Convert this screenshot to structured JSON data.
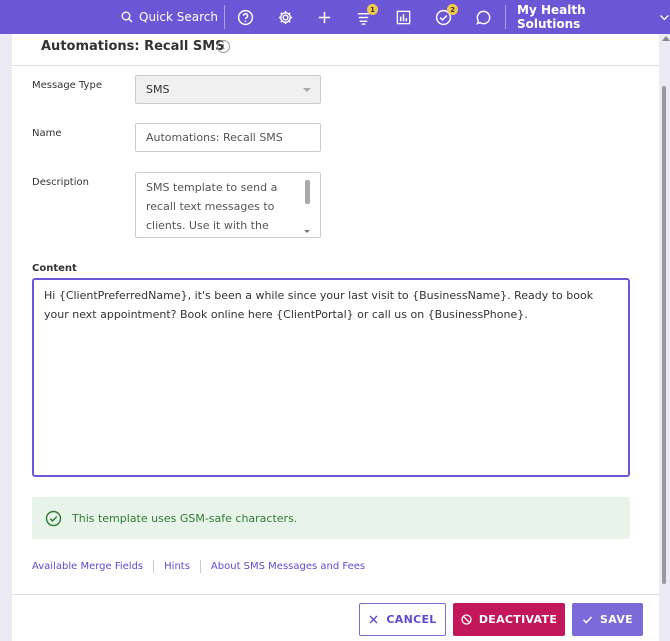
{
  "topbar": {
    "quick_search": "Quick Search",
    "queue_badge": "1",
    "tasks_badge": "2",
    "org_name": "My Health Solutions"
  },
  "page": {
    "title": "Automations: Recall SMS"
  },
  "form": {
    "message_type_label": "Message Type",
    "message_type_value": "SMS",
    "name_label": "Name",
    "name_value": "Automations: Recall SMS",
    "description_label": "Description",
    "description_value": "SMS template to send a recall text messages to clients. Use it with the recall",
    "content_label": "Content",
    "content_value": "Hi {ClientPreferredName}, it's been a while since your last visit to {BusinessName}. Ready to book your next appointment? Book online here {ClientPortal} or call us on {BusinessPhone}."
  },
  "gsm_notice": "This template uses GSM-safe characters.",
  "links": {
    "merge_fields": "Available Merge Fields",
    "hints": "Hints",
    "about_sms": "About SMS Messages and Fees"
  },
  "buttons": {
    "cancel": "CANCEL",
    "deactivate": "DEACTIVATE",
    "save": "SAVE"
  },
  "colors": {
    "brand": "#6b57d6",
    "danger": "#c2185b",
    "success": "#2e7d32"
  }
}
